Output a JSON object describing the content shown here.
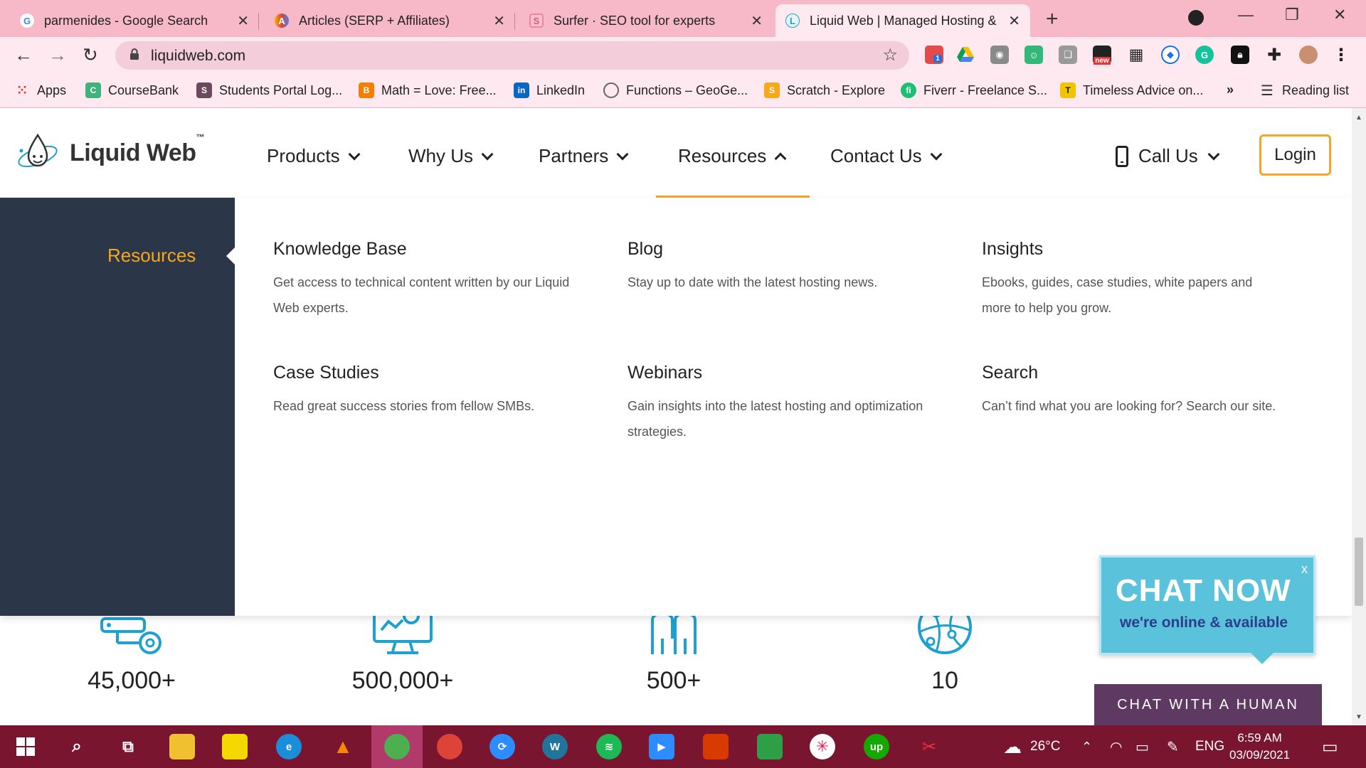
{
  "browser": {
    "tabs": [
      {
        "title": "parmenides - Google Search",
        "favicon": "G"
      },
      {
        "title": "Articles (SERP + Affiliates)",
        "favicon": "A"
      },
      {
        "title": "Surfer · SEO tool for experts",
        "favicon": "S"
      },
      {
        "title": "Liquid Web | Managed Hosting &",
        "favicon": "L"
      }
    ],
    "url": "liquidweb.com",
    "bookmarks": [
      {
        "label": "Apps"
      },
      {
        "label": "CourseBank"
      },
      {
        "label": "Students Portal Log..."
      },
      {
        "label": "Math = Love: Free..."
      },
      {
        "label": "LinkedIn"
      },
      {
        "label": "Functions – GeoGe..."
      },
      {
        "label": "Scratch - Explore"
      },
      {
        "label": "Fiverr - Freelance S..."
      },
      {
        "label": "Timeless Advice on..."
      }
    ],
    "overflow": "»",
    "reading_list": "Reading list",
    "ext_badge": "1",
    "ext_new": "new"
  },
  "site": {
    "logo": "Liquid Web",
    "logo_tm": "™",
    "nav": [
      {
        "label": "Products"
      },
      {
        "label": "Why Us"
      },
      {
        "label": "Partners"
      },
      {
        "label": "Resources"
      },
      {
        "label": "Contact Us"
      }
    ],
    "call_us": "Call Us",
    "login": "Login",
    "megamenu": {
      "side_label": "Resources",
      "items": [
        {
          "title": "Knowledge Base",
          "desc": "Get access to technical content written by our Liquid Web experts."
        },
        {
          "title": "Blog",
          "desc": "Stay up to date with the latest hosting news."
        },
        {
          "title": "Insights",
          "desc": "Ebooks, guides, case studies, white papers and more to help you grow."
        },
        {
          "title": "Case Studies",
          "desc": "Read great success stories from fellow SMBs."
        },
        {
          "title": "Webinars",
          "desc": "Gain insights into the latest hosting and optimization strategies."
        },
        {
          "title": "Search",
          "desc": "Can’t find what you are looking for? Search our site."
        }
      ]
    },
    "stats": [
      "45,000+",
      "500,000+",
      "500+",
      "10"
    ],
    "chat_now": {
      "title": "CHAT NOW",
      "subtitle": "we're online & available",
      "close": "x"
    },
    "chat_human": "CHAT WITH A HUMAN"
  },
  "taskbar": {
    "weather": "26°C",
    "lang": "ENG",
    "time": "6:59 AM",
    "date": "03/09/2021"
  },
  "colors": {
    "accent": "#f5a623",
    "sidebar": "#2b3648",
    "icon_blue": "#1da1d0",
    "tabbar": "#f7b8c8",
    "taskbar": "#7a1530"
  }
}
